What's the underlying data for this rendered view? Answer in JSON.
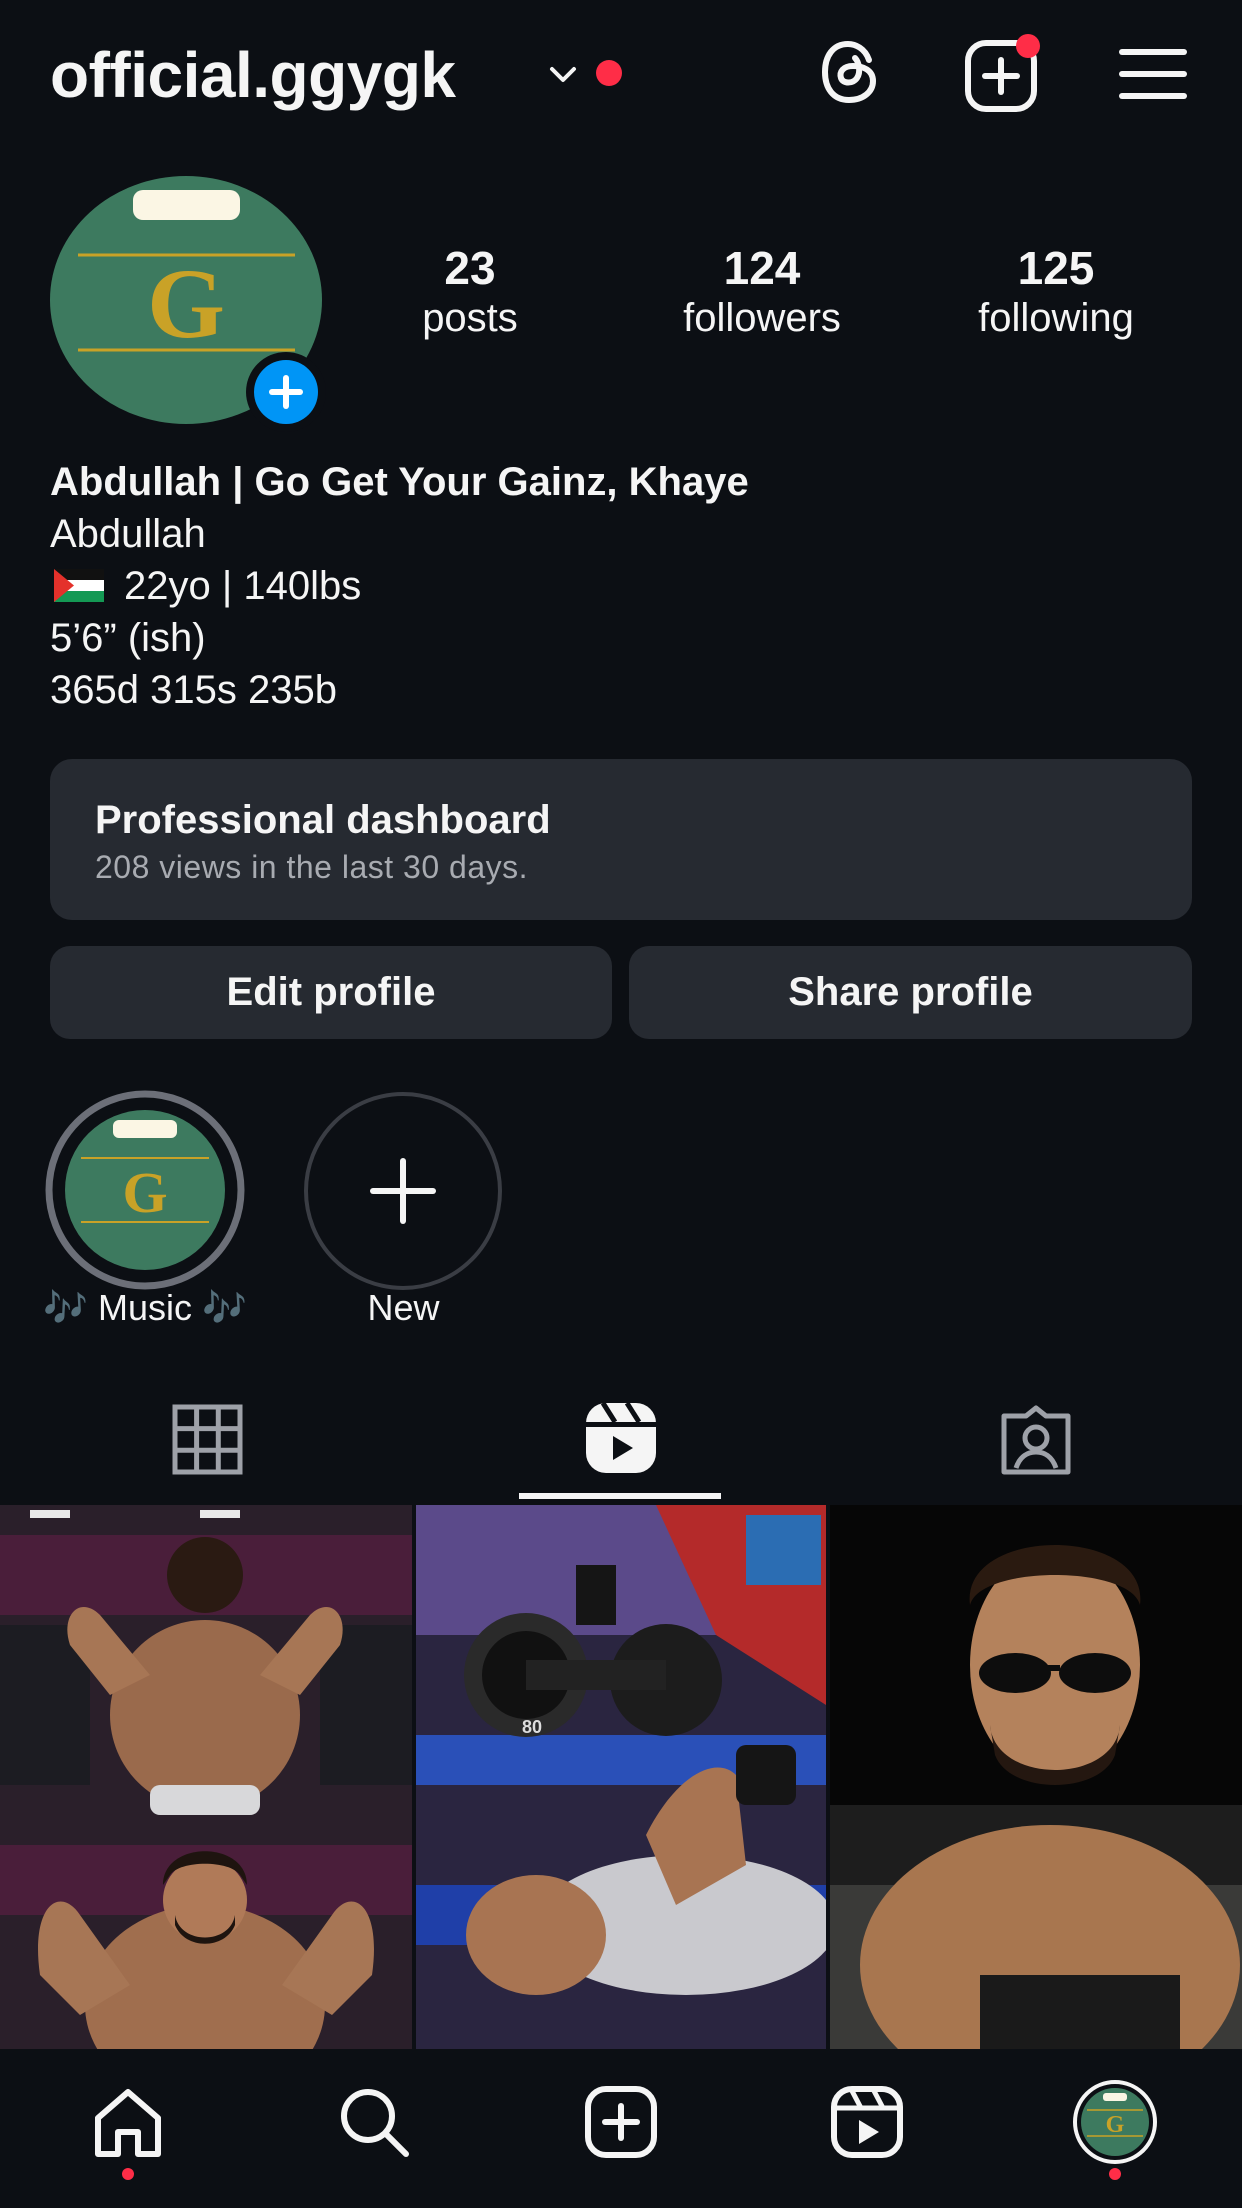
{
  "header": {
    "username": "official.ggygk",
    "icons": [
      "chevron-down-icon",
      "threads-icon",
      "create-icon",
      "menu-icon"
    ]
  },
  "profile": {
    "avatar_letter": "G",
    "stats": [
      {
        "value": "23",
        "label": "posts"
      },
      {
        "value": "124",
        "label": "followers"
      },
      {
        "value": "125",
        "label": "following"
      }
    ],
    "bio": {
      "name": "Abdullah | Go Get Your Gainz, Khaye",
      "line1": "Abdullah",
      "line2": "22yo | 140lbs",
      "line3": "5’6” (ish)",
      "line4": "365d 315s 235b"
    }
  },
  "dashboard": {
    "title": "Professional dashboard",
    "subtitle": "208 views in the last 30 days."
  },
  "buttons": {
    "edit": "Edit profile",
    "share": "Share profile"
  },
  "highlights": [
    {
      "label": "🎶 Music 🎶"
    },
    {
      "label": "New"
    }
  ],
  "tabs": {
    "active": "reels",
    "items": [
      "grid-icon",
      "reels-icon",
      "tagged-icon"
    ]
  },
  "thumbnail_counters": [
    "80"
  ],
  "colors": {
    "background": "#0c0f14",
    "surface": "#262a31",
    "accent_blue": "#0095f6",
    "notification_red": "#ff2d47",
    "avatar_green": "#3d7a5f",
    "avatar_gold": "#c9a227"
  }
}
